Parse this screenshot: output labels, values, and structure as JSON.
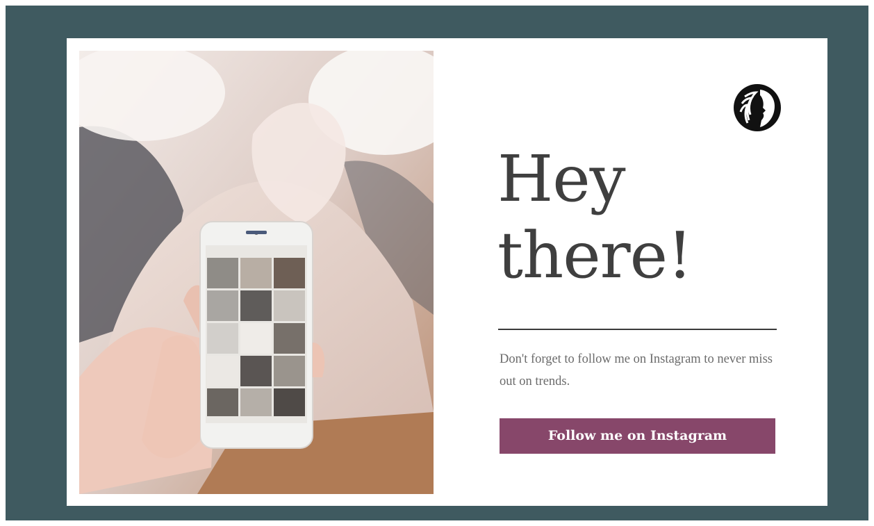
{
  "colors": {
    "backdrop": "#3f5a60",
    "card": "#ffffff",
    "heading": "#3f3f3f",
    "subtext": "#6b6b6b",
    "button": "#87476a",
    "button_text": "#ffffff"
  },
  "hero": {
    "image_subject": "hand holding phone with Instagram grid",
    "logo_icon": "woman-profile-logo"
  },
  "content": {
    "headline_line1": "Hey",
    "headline_line2": "there!",
    "message": "Don't forget to follow me on Instagram to never miss out on trends.",
    "cta_label": "Follow me on Instagram"
  }
}
